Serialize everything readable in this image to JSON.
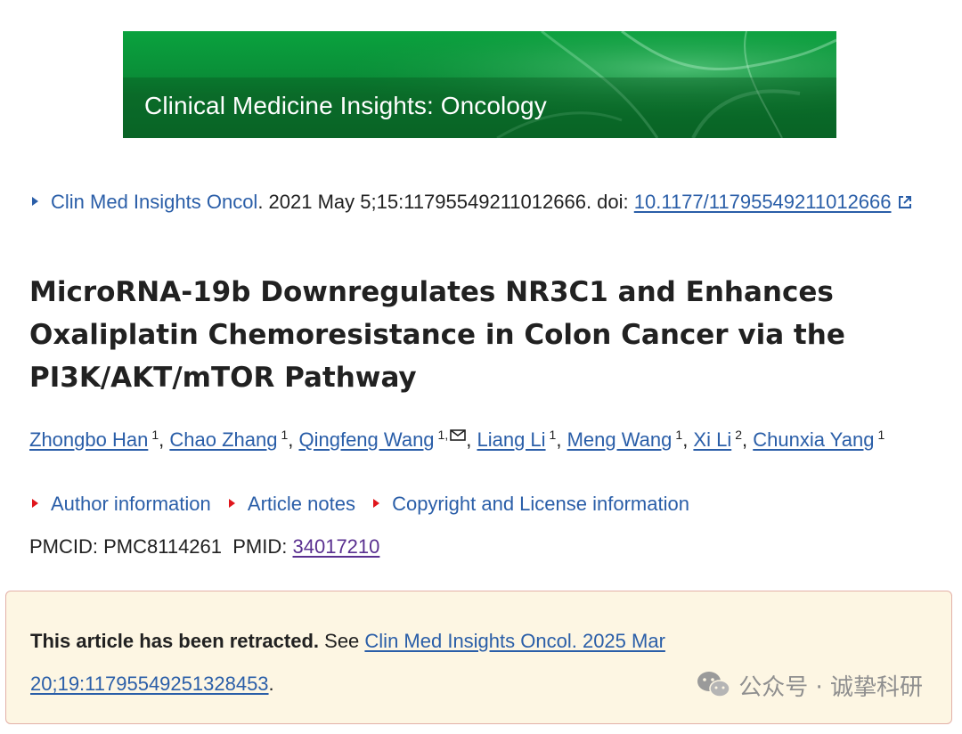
{
  "journal_banner": {
    "title": "Clinical Medicine Insights: Oncology"
  },
  "citation": {
    "journal_link": "Clin Med Insights Oncol",
    "details": ". 2021 May 5;15:11795549211012666. doi: ",
    "doi_link": "10.1177/11795549211012666"
  },
  "article": {
    "title": "MicroRNA-19b Downregulates NR3C1 and Enhances Oxaliplatin Chemoresistance in Colon Cancer via the PI3K/AKT/mTOR Pathway"
  },
  "authors": [
    {
      "name": "Zhongbo Han",
      "affil": "1"
    },
    {
      "name": "Chao Zhang",
      "affil": "1"
    },
    {
      "name": "Qingfeng Wang",
      "affil": "1,"
    },
    {
      "name": "Liang Li",
      "affil": "1"
    },
    {
      "name": "Meng Wang",
      "affil": "1"
    },
    {
      "name": "Xi Li",
      "affil": "2"
    },
    {
      "name": "Chunxia Yang",
      "affil": "1"
    }
  ],
  "info_links": {
    "author_information": "Author information",
    "article_notes": "Article notes",
    "copyright": "Copyright and License information"
  },
  "identifiers": {
    "pmcid_label": "PMCID: PMC8114261",
    "pmid_label": "PMID:",
    "pmid_value": "34017210"
  },
  "retraction": {
    "bold_text": "This article has been retracted.",
    "see_text": " See ",
    "link_text": "Clin Med Insights Oncol. 2025 Mar 20;19:11795549251328453",
    "trailing": "."
  },
  "watermark": {
    "text": "公众号 · 诚挚科研"
  },
  "colors": {
    "link": "#2a5ea8",
    "visited_link": "#5a3090",
    "bullet_red": "#e0161c",
    "banner_green": "#0a8f38",
    "retraction_bg": "#fdf6e3"
  }
}
